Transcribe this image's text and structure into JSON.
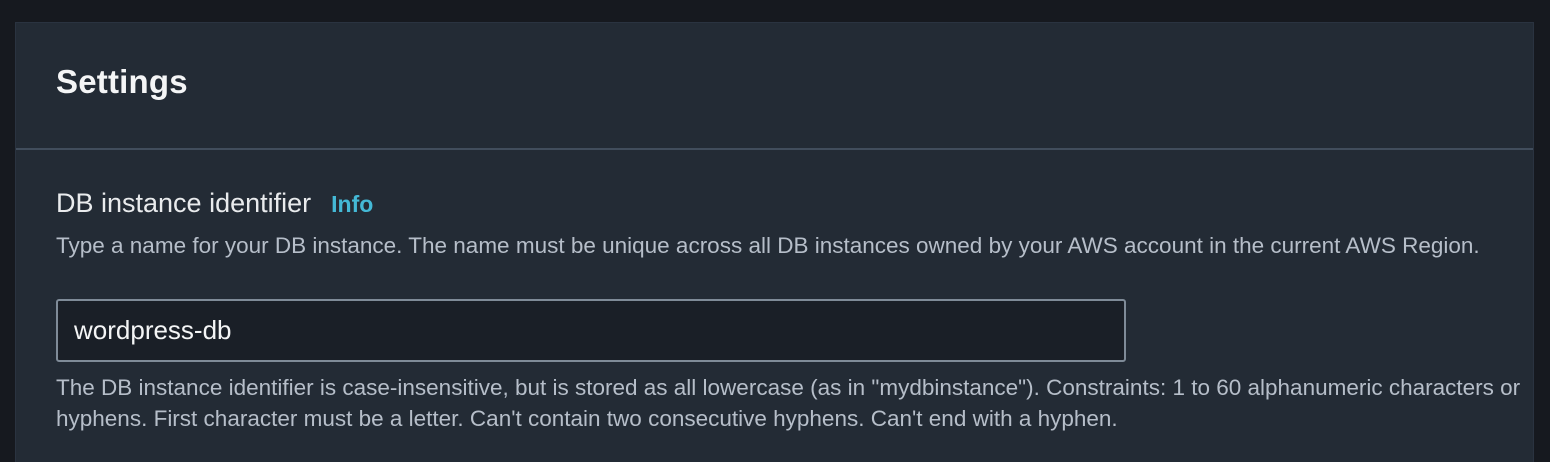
{
  "settings": {
    "title": "Settings",
    "db_identifier": {
      "label": "DB instance identifier",
      "info_label": "Info",
      "description": "Type a name for your DB instance. The name must be unique across all DB instances owned by your AWS account in the current AWS Region.",
      "value": "wordpress-db",
      "constraint": "The DB instance identifier is case-insensitive, but is stored as all lowercase (as in \"mydbinstance\"). Constraints: 1 to 60 alphanumeric characters or hyphens. First character must be a letter. Can't contain two consecutive hyphens. Can't end with a hyphen."
    }
  },
  "colors": {
    "page_background": "#16191f",
    "panel_background": "#232b35",
    "input_background": "#1a1f27",
    "info_link": "#44b9d6",
    "title_text": "#f4f5f6",
    "secondary_text": "#b6bec9"
  }
}
